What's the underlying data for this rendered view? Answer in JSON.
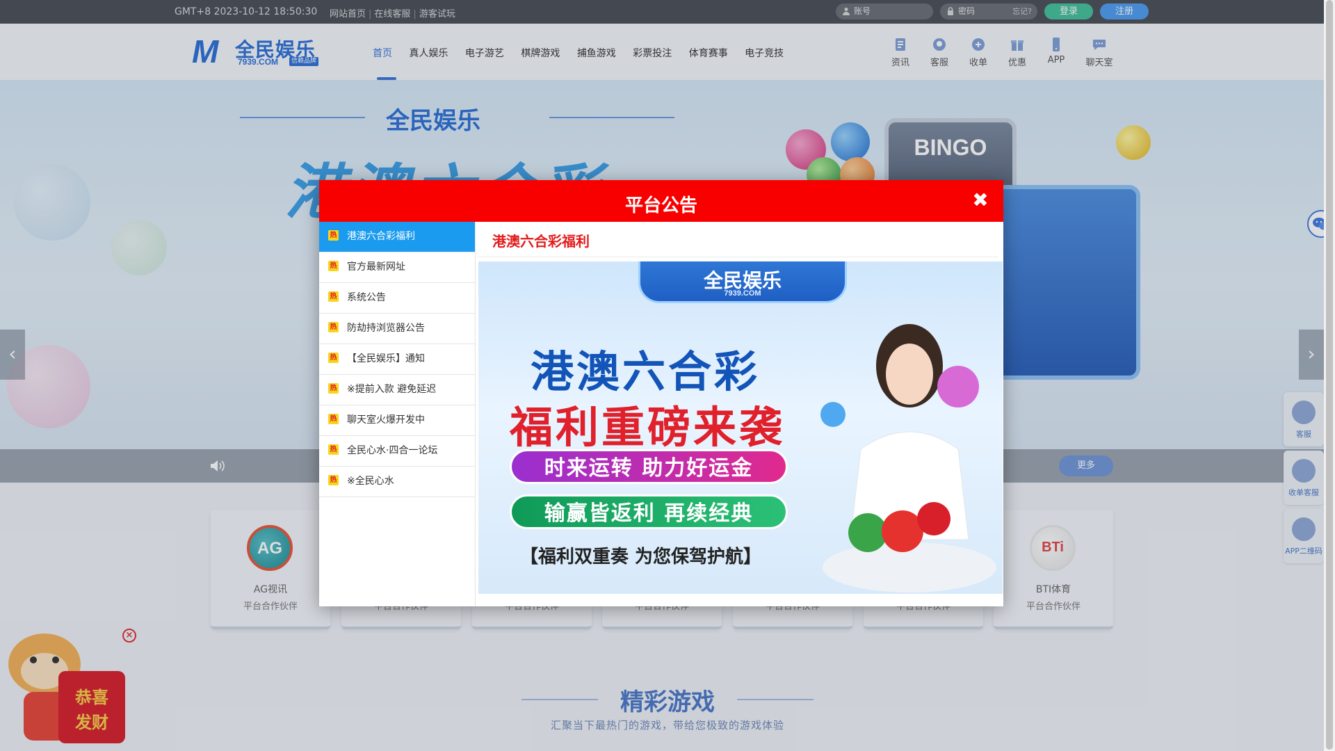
{
  "topbar": {
    "time": "GMT+8   2023-10-12 18:50:30",
    "links": [
      "网站首页",
      "在线客服",
      "游客试玩"
    ],
    "account_placeholder": "账号",
    "password_placeholder": "密码",
    "forgot": "忘记?",
    "login": "登录",
    "register": "注册"
  },
  "header": {
    "logo_m": "M",
    "logo_cn": "全民娱乐",
    "logo_en": "7939.COM",
    "logo_tag": "信赖品牌",
    "nav": [
      "首页",
      "真人娱乐",
      "电子游艺",
      "棋牌游戏",
      "捕鱼游戏",
      "彩票投注",
      "体育赛事",
      "电子竞技"
    ],
    "quick": [
      {
        "label": "资讯",
        "icon": "news-icon"
      },
      {
        "label": "客服",
        "icon": "support-icon"
      },
      {
        "label": "收单",
        "icon": "receipt-icon"
      },
      {
        "label": "优惠",
        "icon": "gift-icon"
      },
      {
        "label": "APP",
        "icon": "phone-icon"
      },
      {
        "label": "聊天室",
        "icon": "chat-icon"
      }
    ]
  },
  "banner": {
    "logo": "全民娱乐",
    "title": "港澳六合彩",
    "bingo": "BINGO",
    "more": "更多"
  },
  "partners": [
    {
      "name": "AG视讯",
      "sub": "平台合作伙伴",
      "logo": "AG"
    },
    {
      "name": "",
      "sub": "平台合作伙伴",
      "logo": ""
    },
    {
      "name": "",
      "sub": "平台合作伙伴",
      "logo": ""
    },
    {
      "name": "",
      "sub": "平台合作伙伴",
      "logo": ""
    },
    {
      "name": "",
      "sub": "平台合作伙伴",
      "logo": ""
    },
    {
      "name": "",
      "sub": "平台合作伙伴",
      "logo": ""
    },
    {
      "name": "BTI体育",
      "sub": "平台合作伙伴",
      "logo": "BTi"
    }
  ],
  "section": {
    "title": "精彩游戏",
    "subtitle": "汇聚当下最热门的游戏，带给您极致的游戏体验"
  },
  "float": [
    {
      "label": "客服"
    },
    {
      "label": "收单客服"
    },
    {
      "label": "APP二维码"
    }
  ],
  "tiger": {
    "text": "恭喜发财"
  },
  "modal": {
    "title": "平台公告",
    "close": "✖",
    "hot": "热",
    "items": [
      "港澳六合彩福利",
      "官方最新网址",
      "系统公告",
      "防劫持浏览器公告",
      "【全民娱乐】通知",
      "※提前入款 避免延迟",
      "聊天室火爆开发中",
      "全民心水·四合一论坛",
      "※全民心水"
    ],
    "active_index": 0,
    "content_title": "港澳六合彩福利",
    "promo": {
      "logo": "全民娱乐",
      "logo_en": "7939.COM",
      "line1": "港澳六合彩",
      "line2": "福利重磅来袭",
      "pill1": "时来运转  助力好运金",
      "pill2": "输赢皆返利  再续经典",
      "footer": "【福利双重奏  为您保驾护航】"
    }
  },
  "colors": {
    "topbar": "#4b4f56",
    "accent": "#3a74d8",
    "modal_red": "#f90000",
    "active_item": "#1a9bf0",
    "login_btn": "#45c09a",
    "register_btn": "#4f9df0"
  }
}
